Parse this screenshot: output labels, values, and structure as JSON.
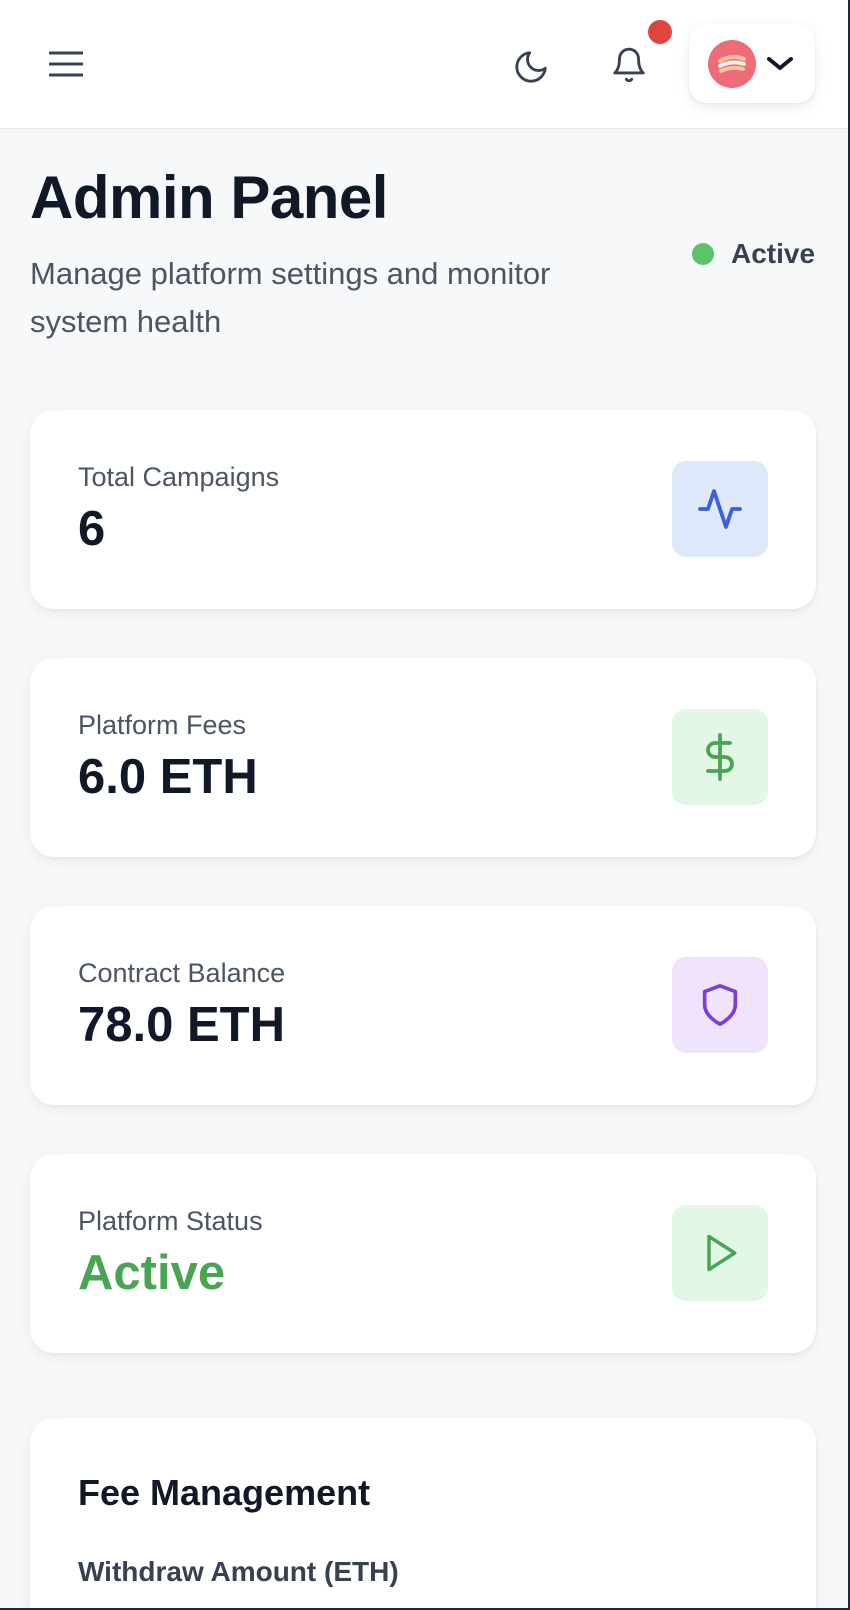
{
  "header": {
    "menu_icon": "hamburger-menu-icon",
    "theme_icon": "moon-icon",
    "notifications_icon": "bell-icon",
    "profile_chevron_icon": "chevron-down-icon"
  },
  "page": {
    "title": "Admin Panel",
    "subtitle": "Manage platform settings and monitor system health",
    "status_label": "Active",
    "status_color": "#5cc36a"
  },
  "stats": [
    {
      "label": "Total Campaigns",
      "value": "6",
      "icon": "activity-icon",
      "accent": "#3b63d9"
    },
    {
      "label": "Platform Fees",
      "value": "6.0 ETH",
      "icon": "dollar-icon",
      "accent": "#4aa553"
    },
    {
      "label": "Contract Balance",
      "value": "78.0 ETH",
      "icon": "shield-icon",
      "accent": "#7c3ed6"
    },
    {
      "label": "Platform Status",
      "value": "Active",
      "icon": "play-icon",
      "accent": "#4aa553"
    }
  ],
  "fee_management": {
    "title": "Fee Management",
    "withdraw_label": "Withdraw Amount (ETH)"
  },
  "colors": {
    "notification_dot": "#e0443e",
    "avatar_bg": "#ee6b77"
  }
}
